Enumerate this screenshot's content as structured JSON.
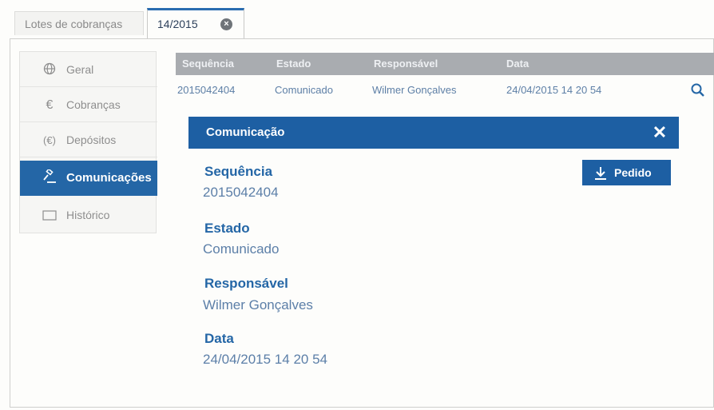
{
  "tabs": [
    {
      "label": "Lotes de cobranças"
    },
    {
      "label": "14/2015"
    }
  ],
  "sidebar": {
    "items": [
      {
        "label": "Geral",
        "icon": "globe-icon"
      },
      {
        "label": "Cobranças",
        "icon": "euro-icon"
      },
      {
        "label": "Depósitos",
        "icon": "euro-box-icon"
      },
      {
        "label": "Comunicações",
        "icon": "gavel-icon",
        "active": true
      },
      {
        "label": "Histórico",
        "icon": "folder-icon"
      }
    ]
  },
  "table": {
    "columns": [
      "Sequência",
      "Estado",
      "Responsável",
      "Data"
    ],
    "rows": [
      {
        "sequencia": "2015042404",
        "estado": "Comunicado",
        "responsavel": "Wilmer Gonçalves",
        "data": "24/04/2015 14 20 54"
      }
    ]
  },
  "modal": {
    "title": "Comunicação",
    "button_label": "Pedido",
    "fields": [
      {
        "label": "Sequência",
        "value": "2015042404"
      },
      {
        "label": "Estado",
        "value": "Comunicado"
      },
      {
        "label": "Responsável",
        "value": "Wilmer Gonçalves"
      },
      {
        "label": "Data",
        "value": "24/04/2015 14 20 54"
      }
    ]
  },
  "colors": {
    "accent": "#2466a6",
    "header_gray": "#a9acb0",
    "value_text": "#5c7fa8"
  }
}
